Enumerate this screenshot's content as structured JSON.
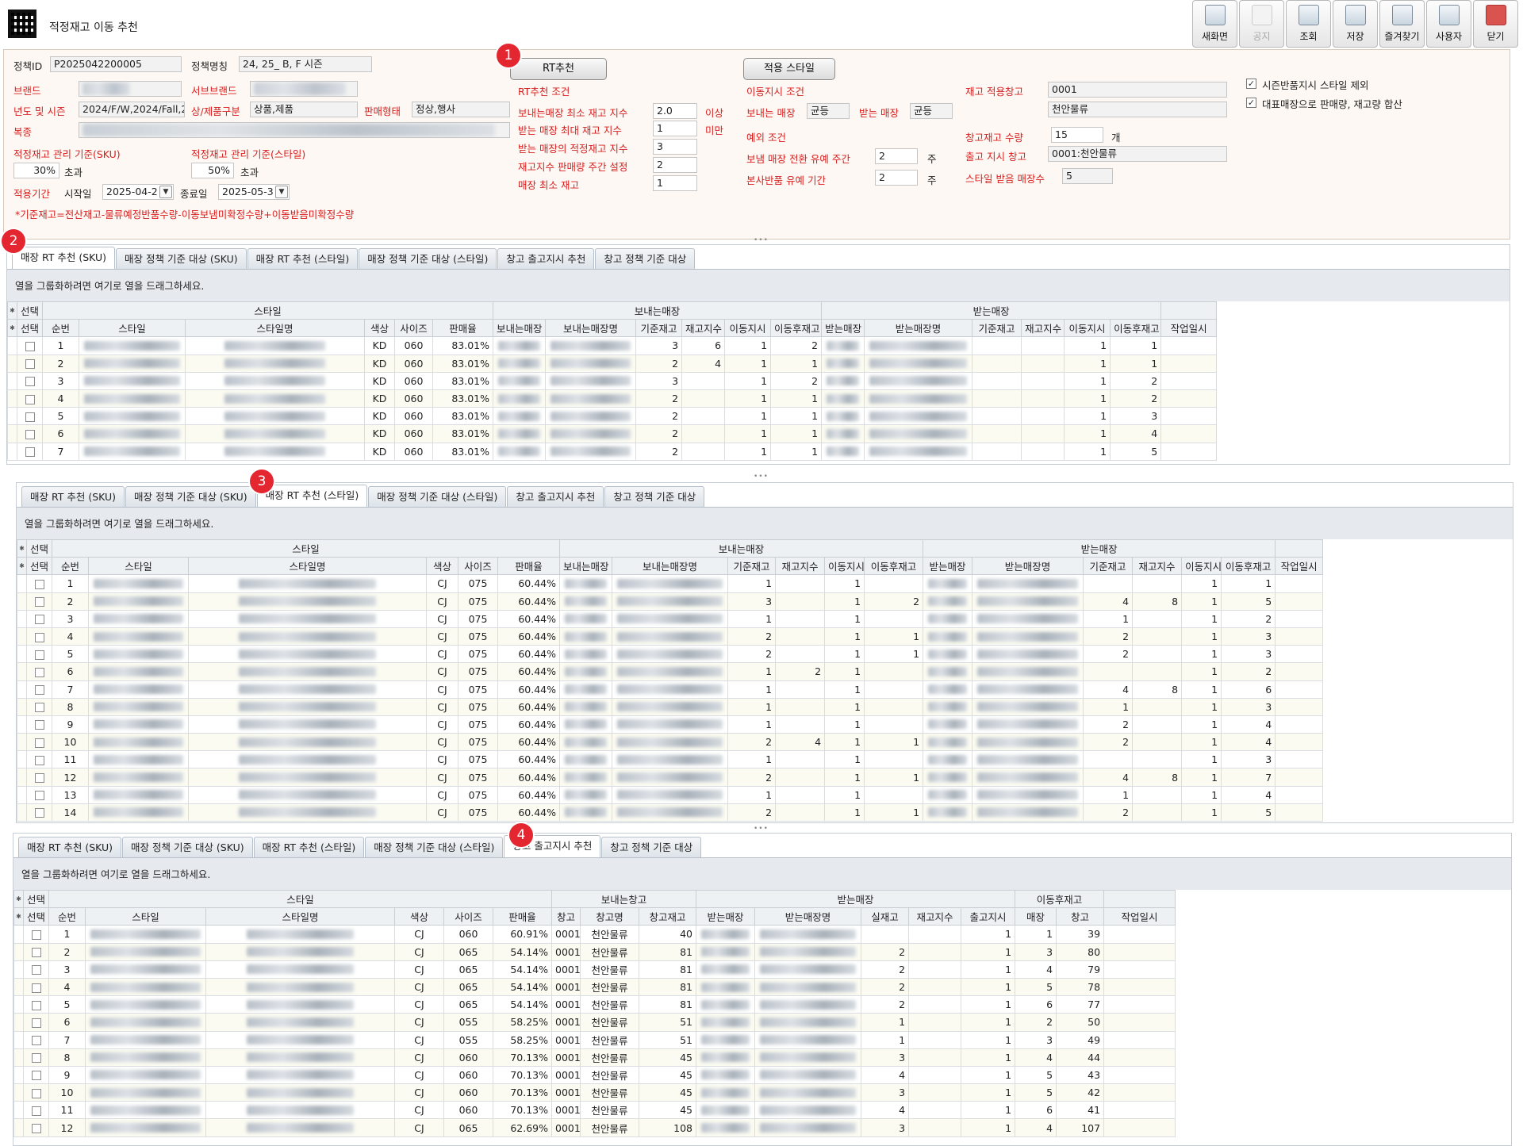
{
  "app": {
    "title": "적정재고 이동 추천"
  },
  "toolbar": {
    "buttons": [
      {
        "label": "새화면",
        "icon": "new-screen-icon",
        "disabled": false
      },
      {
        "label": "공지",
        "icon": "notice-icon",
        "disabled": true
      },
      {
        "label": "조회",
        "icon": "search-icon",
        "disabled": false
      },
      {
        "label": "저장",
        "icon": "save-icon",
        "disabled": false
      },
      {
        "label": "즐겨찾기",
        "icon": "star-icon",
        "disabled": false
      },
      {
        "label": "사용자",
        "icon": "user-icon",
        "disabled": false
      },
      {
        "label": "닫기",
        "icon": "close-icon",
        "disabled": false
      }
    ]
  },
  "badges": [
    "1",
    "2",
    "3",
    "4"
  ],
  "filters": {
    "policy_id": {
      "label": "정책ID",
      "value": "P2025042200005"
    },
    "policy_name": {
      "label": "정책명칭",
      "value": "24, 25_ B, F 시즌"
    },
    "brand": {
      "label": "브랜드"
    },
    "sub_brand": {
      "label": "서브브랜드"
    },
    "year_season": {
      "label": "년도 및 시즌",
      "value": "2024/F/W,2024/Fall,2"
    },
    "product_type": {
      "label": "상/제품구분",
      "value": "상품,제품"
    },
    "sale_type": {
      "label": "판매형태",
      "value": "정상,행사"
    },
    "category": {
      "label": "복종"
    },
    "mgmt_sku": {
      "label": "적정재고 관리 기준(SKU)",
      "value": "30%",
      "suffix": "초과"
    },
    "mgmt_style": {
      "label": "적정재고 관리 기준(스타일)",
      "value": "50%",
      "suffix": "초과"
    },
    "period": {
      "label": "적용기간",
      "start_label": "시작일",
      "start": "2025-04-2",
      "end_label": "종료일",
      "end": "2025-05-3"
    },
    "note": "*기준재고=전산재고-물류예정반품수량-이동보냄미확정수량+이동받음미확정수량"
  },
  "rt": {
    "button": "RT추천",
    "title": "RT추천 조건",
    "rows": [
      {
        "label": "보내는매장 최소 재고 지수",
        "value": "2.0",
        "unit": "이상"
      },
      {
        "label": "받는 매장 최대 재고 지수",
        "value": "1",
        "unit": "미만"
      },
      {
        "label": "받는 매장의 적정재고 지수",
        "value": "3"
      },
      {
        "label": "재고지수 판매량 주간 설정",
        "value": "2"
      },
      {
        "label": "매장 최소 재고",
        "value": "1"
      }
    ]
  },
  "style_apply": {
    "button": "적용 스타일",
    "move_cond": "이동지시 조건",
    "send_label": "보내는 매장",
    "send_value": "균등",
    "recv_label": "받는 매장",
    "recv_value": "균등",
    "exception": "예외 조건",
    "grace_label": "보냄 매장 전환 유예 주간",
    "grace_value": "2",
    "grace_unit": "주",
    "return_label": "본사반품 유예 기간",
    "return_value": "2",
    "return_unit": "주"
  },
  "warehouse": {
    "apply_label": "재고 적용창고",
    "apply_code": "0001",
    "apply_name": "천안물류",
    "qty_label": "창고재고 수량",
    "qty_value": "15",
    "qty_unit": "개",
    "out_label": "출고 지시 창고",
    "out_value": "0001:천안물류",
    "recv_count_label": "스타일 받음 매장수",
    "recv_count_value": "5"
  },
  "options": {
    "opt1": {
      "label": "시즌반품지시 스타일 제외",
      "checked": true
    },
    "opt2": {
      "label": "대표매장으로 판매량, 재고량 합산",
      "checked": true
    }
  },
  "tabs": [
    "매장 RT 추천 (SKU)",
    "매장 정책 기준 대상 (SKU)",
    "매장 RT 추천 (스타일)",
    "매장 정책 기준 대상 (스타일)",
    "창고 출고지시 추천",
    "창고 정책 기준 대상"
  ],
  "group_hint": "열을 그룹화하려면 여기로 열을 드래그하세요.",
  "headers": {
    "select": "선택",
    "seq": "순번",
    "style": "스타일",
    "style_name": "스타일명",
    "color": "색상",
    "size": "사이즈",
    "sale_rate": "판매율",
    "send_store_group": "보내는매장",
    "send_store": "보내는매장",
    "send_store_name": "보내는매장명",
    "base_stock": "기준재고",
    "stock_index": "재고지수",
    "move_qty": "이동지시",
    "after_stock": "이동후재고",
    "recv_store_group": "받는매장",
    "recv_store": "받는매장",
    "recv_store_name": "받는매장명",
    "work_time": "작업일시",
    "send_wh_group": "보내는창고",
    "wh": "창고",
    "wh_name": "창고명",
    "wh_stock": "창고재고",
    "real_stock": "실재고",
    "out_qty": "출고지시",
    "after_group": "이동후재고",
    "after_store": "매장",
    "after_wh": "창고"
  },
  "grid1": {
    "rows": [
      {
        "seq": "1",
        "color": "KD",
        "size": "060",
        "rate": "83.01%",
        "sb": "3",
        "si": "6",
        "sm": "1",
        "sa": "2",
        "rb": "",
        "ri": "",
        "rm": "1",
        "ra": "1"
      },
      {
        "seq": "2",
        "color": "KD",
        "size": "060",
        "rate": "83.01%",
        "sb": "2",
        "si": "4",
        "sm": "1",
        "sa": "1",
        "rb": "",
        "ri": "",
        "rm": "1",
        "ra": "1"
      },
      {
        "seq": "3",
        "color": "KD",
        "size": "060",
        "rate": "83.01%",
        "sb": "3",
        "si": "",
        "sm": "1",
        "sa": "2",
        "rb": "",
        "ri": "",
        "rm": "1",
        "ra": "2"
      },
      {
        "seq": "4",
        "color": "KD",
        "size": "060",
        "rate": "83.01%",
        "sb": "2",
        "si": "",
        "sm": "1",
        "sa": "1",
        "rb": "",
        "ri": "",
        "rm": "1",
        "ra": "2"
      },
      {
        "seq": "5",
        "color": "KD",
        "size": "060",
        "rate": "83.01%",
        "sb": "2",
        "si": "",
        "sm": "1",
        "sa": "1",
        "rb": "",
        "ri": "",
        "rm": "1",
        "ra": "3"
      },
      {
        "seq": "6",
        "color": "KD",
        "size": "060",
        "rate": "83.01%",
        "sb": "2",
        "si": "",
        "sm": "1",
        "sa": "1",
        "rb": "",
        "ri": "",
        "rm": "1",
        "ra": "4"
      },
      {
        "seq": "7",
        "color": "KD",
        "size": "060",
        "rate": "83.01%",
        "sb": "2",
        "si": "",
        "sm": "1",
        "sa": "1",
        "rb": "",
        "ri": "",
        "rm": "1",
        "ra": "5"
      }
    ]
  },
  "grid2": {
    "rows": [
      {
        "seq": "1",
        "color": "CJ",
        "size": "075",
        "rate": "60.44%",
        "sb": "1",
        "si": "",
        "sm": "1",
        "sa": "",
        "rb": "",
        "ri": "",
        "rm": "1",
        "ra": "1"
      },
      {
        "seq": "2",
        "color": "CJ",
        "size": "075",
        "rate": "60.44%",
        "sb": "3",
        "si": "",
        "sm": "1",
        "sa": "2",
        "rb": "4",
        "ri": "8",
        "rm": "1",
        "ra": "5"
      },
      {
        "seq": "3",
        "color": "CJ",
        "size": "075",
        "rate": "60.44%",
        "sb": "1",
        "si": "",
        "sm": "1",
        "sa": "",
        "rb": "1",
        "ri": "",
        "rm": "1",
        "ra": "2"
      },
      {
        "seq": "4",
        "color": "CJ",
        "size": "075",
        "rate": "60.44%",
        "sb": "2",
        "si": "",
        "sm": "1",
        "sa": "1",
        "rb": "2",
        "ri": "",
        "rm": "1",
        "ra": "3"
      },
      {
        "seq": "5",
        "color": "CJ",
        "size": "075",
        "rate": "60.44%",
        "sb": "2",
        "si": "",
        "sm": "1",
        "sa": "1",
        "rb": "2",
        "ri": "",
        "rm": "1",
        "ra": "3"
      },
      {
        "seq": "6",
        "color": "CJ",
        "size": "075",
        "rate": "60.44%",
        "sb": "1",
        "si": "2",
        "sm": "1",
        "sa": "",
        "rb": "",
        "ri": "",
        "rm": "1",
        "ra": "2"
      },
      {
        "seq": "7",
        "color": "CJ",
        "size": "075",
        "rate": "60.44%",
        "sb": "1",
        "si": "",
        "sm": "1",
        "sa": "",
        "rb": "4",
        "ri": "8",
        "rm": "1",
        "ra": "6"
      },
      {
        "seq": "8",
        "color": "CJ",
        "size": "075",
        "rate": "60.44%",
        "sb": "1",
        "si": "",
        "sm": "1",
        "sa": "",
        "rb": "1",
        "ri": "",
        "rm": "1",
        "ra": "3"
      },
      {
        "seq": "9",
        "color": "CJ",
        "size": "075",
        "rate": "60.44%",
        "sb": "1",
        "si": "",
        "sm": "1",
        "sa": "",
        "rb": "2",
        "ri": "",
        "rm": "1",
        "ra": "4"
      },
      {
        "seq": "10",
        "color": "CJ",
        "size": "075",
        "rate": "60.44%",
        "sb": "2",
        "si": "4",
        "sm": "1",
        "sa": "1",
        "rb": "2",
        "ri": "",
        "rm": "1",
        "ra": "4"
      },
      {
        "seq": "11",
        "color": "CJ",
        "size": "075",
        "rate": "60.44%",
        "sb": "1",
        "si": "",
        "sm": "1",
        "sa": "",
        "rb": "",
        "ri": "",
        "rm": "1",
        "ra": "3"
      },
      {
        "seq": "12",
        "color": "CJ",
        "size": "075",
        "rate": "60.44%",
        "sb": "2",
        "si": "",
        "sm": "1",
        "sa": "1",
        "rb": "4",
        "ri": "8",
        "rm": "1",
        "ra": "7"
      },
      {
        "seq": "13",
        "color": "CJ",
        "size": "075",
        "rate": "60.44%",
        "sb": "1",
        "si": "",
        "sm": "1",
        "sa": "",
        "rb": "1",
        "ri": "",
        "rm": "1",
        "ra": "4"
      },
      {
        "seq": "14",
        "color": "CJ",
        "size": "075",
        "rate": "60.44%",
        "sb": "2",
        "si": "",
        "sm": "1",
        "sa": "1",
        "rb": "2",
        "ri": "",
        "rm": "1",
        "ra": "5"
      }
    ]
  },
  "grid3": {
    "rows": [
      {
        "seq": "1",
        "color": "CJ",
        "size": "060",
        "rate": "60.91%",
        "wh": "0001",
        "whn": "천안물류",
        "ws": "40",
        "real": "",
        "idx": "",
        "out": "1",
        "as": "1",
        "aw": "39"
      },
      {
        "seq": "2",
        "color": "CJ",
        "size": "065",
        "rate": "54.14%",
        "wh": "0001",
        "whn": "천안물류",
        "ws": "81",
        "real": "2",
        "idx": "",
        "out": "1",
        "as": "3",
        "aw": "80"
      },
      {
        "seq": "3",
        "color": "CJ",
        "size": "065",
        "rate": "54.14%",
        "wh": "0001",
        "whn": "천안물류",
        "ws": "81",
        "real": "2",
        "idx": "",
        "out": "1",
        "as": "4",
        "aw": "79"
      },
      {
        "seq": "4",
        "color": "CJ",
        "size": "065",
        "rate": "54.14%",
        "wh": "0001",
        "whn": "천안물류",
        "ws": "81",
        "real": "2",
        "idx": "",
        "out": "1",
        "as": "5",
        "aw": "78"
      },
      {
        "seq": "5",
        "color": "CJ",
        "size": "065",
        "rate": "54.14%",
        "wh": "0001",
        "whn": "천안물류",
        "ws": "81",
        "real": "2",
        "idx": "",
        "out": "1",
        "as": "6",
        "aw": "77"
      },
      {
        "seq": "6",
        "color": "CJ",
        "size": "055",
        "rate": "58.25%",
        "wh": "0001",
        "whn": "천안물류",
        "ws": "51",
        "real": "1",
        "idx": "",
        "out": "1",
        "as": "2",
        "aw": "50"
      },
      {
        "seq": "7",
        "color": "CJ",
        "size": "055",
        "rate": "58.25%",
        "wh": "0001",
        "whn": "천안물류",
        "ws": "51",
        "real": "1",
        "idx": "",
        "out": "1",
        "as": "3",
        "aw": "49"
      },
      {
        "seq": "8",
        "color": "CJ",
        "size": "060",
        "rate": "70.13%",
        "wh": "0001",
        "whn": "천안물류",
        "ws": "45",
        "real": "3",
        "idx": "",
        "out": "1",
        "as": "4",
        "aw": "44"
      },
      {
        "seq": "9",
        "color": "CJ",
        "size": "060",
        "rate": "70.13%",
        "wh": "0001",
        "whn": "천안물류",
        "ws": "45",
        "real": "4",
        "idx": "",
        "out": "1",
        "as": "5",
        "aw": "43"
      },
      {
        "seq": "10",
        "color": "CJ",
        "size": "060",
        "rate": "70.13%",
        "wh": "0001",
        "whn": "천안물류",
        "ws": "45",
        "real": "3",
        "idx": "",
        "out": "1",
        "as": "5",
        "aw": "42"
      },
      {
        "seq": "11",
        "color": "CJ",
        "size": "060",
        "rate": "70.13%",
        "wh": "0001",
        "whn": "천안물류",
        "ws": "45",
        "real": "4",
        "idx": "",
        "out": "1",
        "as": "6",
        "aw": "41"
      },
      {
        "seq": "12",
        "color": "CJ",
        "size": "065",
        "rate": "62.69%",
        "wh": "0001",
        "whn": "천안물류",
        "ws": "108",
        "real": "3",
        "idx": "",
        "out": "1",
        "as": "4",
        "aw": "107"
      }
    ]
  }
}
